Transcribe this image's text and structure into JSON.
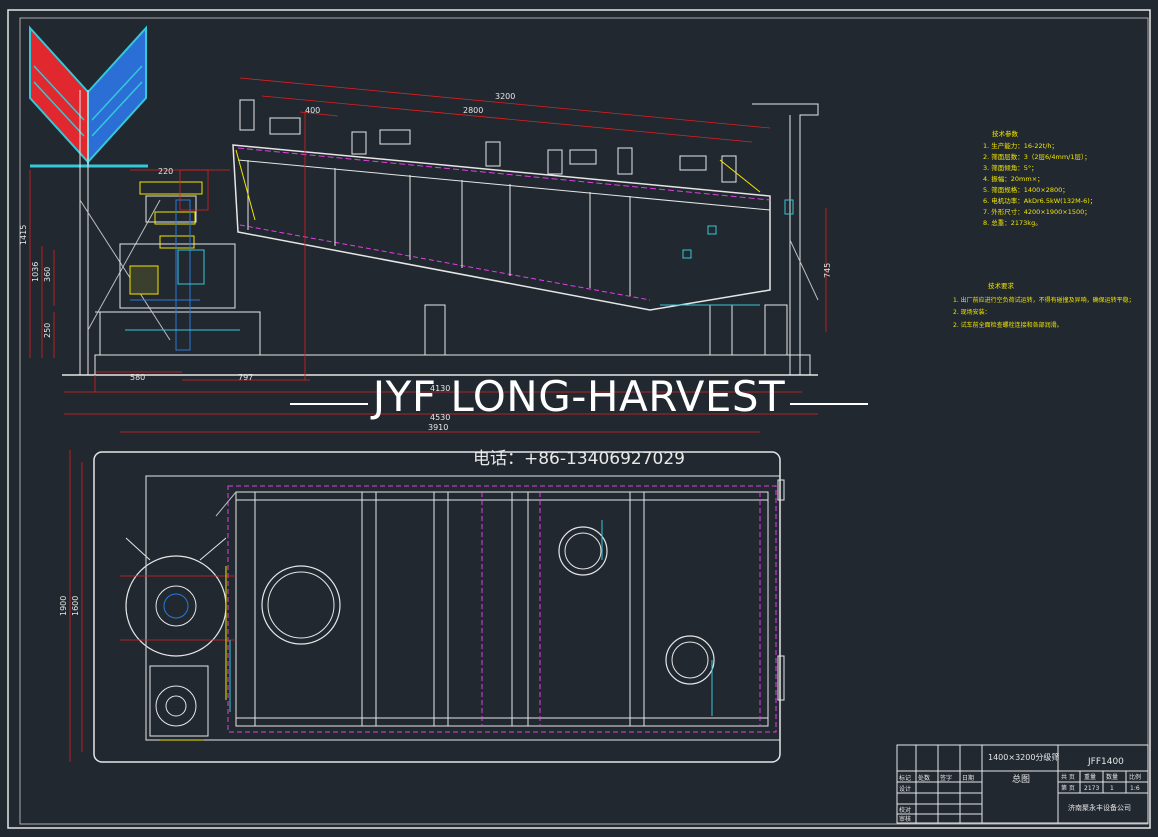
{
  "colors": {
    "background": "#212830",
    "outline": "#e6e6e6",
    "accent_yellow": "#f2e600",
    "accent_magenta": "#e040e0",
    "accent_cyan": "#35c8d8",
    "accent_red": "#e02020",
    "accent_blue": "#2a78d8",
    "accent_green": "#33dd33",
    "logo_red": "#e0282e",
    "logo_blue": "#2b6fd6"
  },
  "logo": {
    "icon": "chevron-v-logo"
  },
  "watermark": {
    "title": "JYF LONG-HARVEST",
    "phone": "电话：+86-13406927029"
  },
  "dimensions": {
    "top_total_length": "3200",
    "top_inner_length": "2800",
    "top_offset": "400",
    "left_height_1": "1415",
    "left_height_2": "1036",
    "left_height_3": "360",
    "left_height_4": "250",
    "left_top_offset": "220",
    "bottom_left_1": "580",
    "bottom_left_2": "797",
    "bottom_span": "4130",
    "overall_length": "4530",
    "right_height": "745",
    "plan_length": "3910",
    "plan_width_outer": "1900",
    "plan_width_inner": "1600"
  },
  "notes": {
    "tech_header": "技术参数",
    "tech_items": [
      "1. 生产能力：16-22t/h；",
      "2. 筛面层数：3（2层6/4mm/1层）；",
      "3. 筛面倾角：5°；",
      "4. 振幅：20mm×；",
      "5. 筛面规格：1400×2800；",
      "6. 电机功率：AkDr6.5kW(132M-6)；",
      "7. 外形尺寸：4200×1900×1500；",
      "8. 总重：2173kg。"
    ],
    "req_header": "技术要求",
    "req_items": [
      "1. 出厂前应进行空负荷试运转，不得有碰撞及异响，确保运转平稳；",
      "2. 现场安装：",
      "2. 试车前全面检查螺栓连接和各部润滑。"
    ]
  },
  "title_block": {
    "drawing_name": "1400×3200分级筛",
    "drawing_type": "总图",
    "drawing_code": "JFF1400",
    "col_headers": [
      "标记",
      "处数",
      "签字",
      "日期"
    ],
    "row_labels": [
      "设计",
      "校对",
      "审核"
    ],
    "meta_headers": [
      "共 页",
      "重量",
      "数量",
      "比例"
    ],
    "meta_values": [
      "第 页",
      "2173",
      "1",
      "1:6"
    ],
    "company": "济南聚永丰设备公司"
  }
}
